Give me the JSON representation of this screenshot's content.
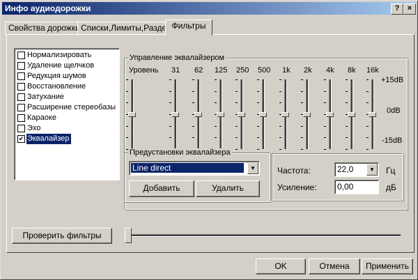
{
  "window": {
    "title": "Инфо аудиодорожки",
    "help_label": "?",
    "close_label": "×"
  },
  "tabs": [
    {
      "label": "Свойства дорожки",
      "active": false
    },
    {
      "label": "Списки,Лимиты,Раздел",
      "active": false
    },
    {
      "label": "Фильтры",
      "active": true
    }
  ],
  "filters": [
    {
      "label": "Нормализировать",
      "checked": false
    },
    {
      "label": "Удаление щелчков",
      "checked": false
    },
    {
      "label": "Редукция шумов",
      "checked": false
    },
    {
      "label": "Восстановление",
      "checked": false
    },
    {
      "label": "Затухание",
      "checked": false
    },
    {
      "label": "Расширение стереобазы",
      "checked": false
    },
    {
      "label": "Караоке",
      "checked": false
    },
    {
      "label": "Эхо",
      "checked": false
    },
    {
      "label": "Эквалайзер",
      "checked": true,
      "selected": true
    }
  ],
  "equalizer": {
    "group_title": "Управление эквалайзером",
    "level_label": "Уровень",
    "bands": [
      {
        "label": "31",
        "value_db": 0
      },
      {
        "label": "62",
        "value_db": 0
      },
      {
        "label": "125",
        "value_db": 0
      },
      {
        "label": "250",
        "value_db": 0
      },
      {
        "label": "500",
        "value_db": 0
      },
      {
        "label": "1k",
        "value_db": 0
      },
      {
        "label": "2k",
        "value_db": 0
      },
      {
        "label": "4k",
        "value_db": 0
      },
      {
        "label": "8k",
        "value_db": 0
      },
      {
        "label": "16k",
        "value_db": 0
      }
    ],
    "master_value_db": 0,
    "scale_top": "+15dB",
    "scale_mid": "0dB",
    "scale_bottom": "-15dB"
  },
  "presets": {
    "group_title": "Предустановки эквалайзера",
    "selected": "Line direct",
    "add_label": "Добавить",
    "delete_label": "Удалить"
  },
  "params": {
    "frequency_label": "Частота:",
    "frequency_value": "22,0",
    "frequency_unit": "Гц",
    "gain_label": "Усиление:",
    "gain_value": "0,00",
    "gain_unit": "дБ"
  },
  "test_button_label": "Проверить фильтры",
  "position_fraction": 0,
  "ok_label": "OK",
  "cancel_label": "Отмена",
  "apply_label": "Применить",
  "icons": {
    "checkmark": "checkmark-icon",
    "dropdown": "chevron-down-icon"
  }
}
